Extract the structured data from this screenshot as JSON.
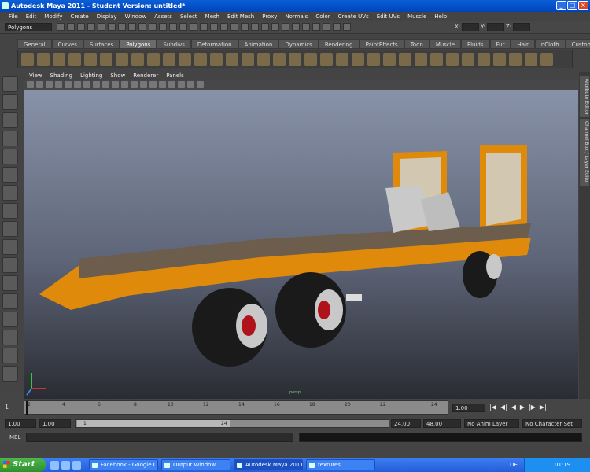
{
  "window": {
    "title": "Autodesk Maya 2011 - Student Version: untitled*"
  },
  "menu": [
    "File",
    "Edit",
    "Modify",
    "Create",
    "Display",
    "Window",
    "Assets",
    "Select",
    "Mesh",
    "Edit Mesh",
    "Proxy",
    "Normals",
    "Color",
    "Create UVs",
    "Edit UVs",
    "Muscle",
    "Help"
  ],
  "status": {
    "mode": "Polygons",
    "x_label": "X:",
    "y_label": "Y:",
    "z_label": "Z:"
  },
  "shelf_tabs": [
    "General",
    "Curves",
    "Surfaces",
    "Polygons",
    "Subdivs",
    "Deformation",
    "Animation",
    "Dynamics",
    "Rendering",
    "PaintEffects",
    "Toon",
    "Muscle",
    "Fluids",
    "Fur",
    "Hair",
    "nCloth",
    "Custom"
  ],
  "shelf_active": "Polygons",
  "viewport": {
    "menu": [
      "View",
      "Shading",
      "Lighting",
      "Show",
      "Renderer",
      "Panels"
    ],
    "camera_label": "persp"
  },
  "side_tabs": [
    "Attribute Editor",
    "Channel Box / Layer Editor"
  ],
  "timeline": {
    "ticks": [
      "1",
      "2",
      "4",
      "6",
      "8",
      "10",
      "12",
      "14",
      "16",
      "18",
      "20",
      "22",
      "24"
    ],
    "start_label": "1",
    "current": "1.00"
  },
  "range": {
    "start": "1.00",
    "start2": "1.00",
    "range_lo": "1",
    "range_hi": "24",
    "end": "24.00",
    "end2": "48.00",
    "anim_layer": "No Anim Layer",
    "character_set": "No Character Set"
  },
  "command": {
    "label": "MEL"
  },
  "taskbar": {
    "start": "Start",
    "tasks": [
      "Facebook - Google C...",
      "Output Window",
      "Autodesk Maya 2011 ...",
      "textures"
    ],
    "active_task": 2,
    "lang": "DE",
    "clock": "01:19"
  },
  "colors": {
    "trailer": "#e08a0c",
    "wheel": "#1a1a1a",
    "hub": "#c8c8c8",
    "deck": "#6c5d4c"
  }
}
